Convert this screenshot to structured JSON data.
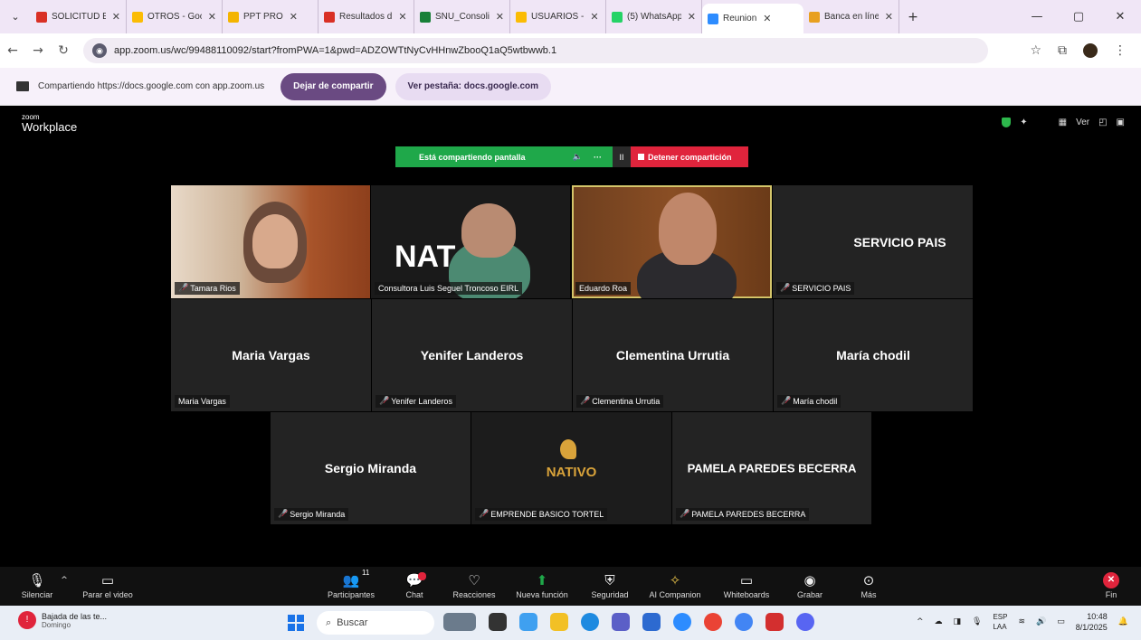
{
  "browser": {
    "tabs": [
      {
        "title": "SOLICITUD E",
        "favicon_color": "#d93025",
        "active": false
      },
      {
        "title": "OTROS - Goo",
        "favicon_color": "#fbbc04",
        "active": false
      },
      {
        "title": "PPT PRO",
        "favicon_color": "#f4b400",
        "active": false
      },
      {
        "title": "Resultados d",
        "favicon_color": "#d93025",
        "active": false
      },
      {
        "title": "SNU_Consoli",
        "favicon_color": "#188038",
        "active": false
      },
      {
        "title": "USUARIOS -",
        "favicon_color": "#fbbc04",
        "active": false
      },
      {
        "title": "(5) WhatsApp",
        "favicon_color": "#25d366",
        "active": false
      },
      {
        "title": "Reunion",
        "favicon_color": "#2d8cff",
        "active": true
      },
      {
        "title": "Banca en líne",
        "favicon_color": "#e8a020",
        "active": false
      }
    ],
    "url": "app.zoom.us/wc/99488110092/start?fromPWA=1&pwd=ADZOWTtNyCvHHnwZbooQ1aQ5wtbwwb.1",
    "sharing_text": "Compartiendo https://docs.google.com con app.zoom.us",
    "stop_sharing_label": "Dejar de compartir",
    "view_tab_label": "Ver pestaña: docs.google.com"
  },
  "zoom": {
    "brand_line1": "zoom",
    "brand_line2": "Workplace",
    "view_label": "Ver",
    "share_status": {
      "label": "Está compartiendo pantalla",
      "more": "···",
      "pause": "II",
      "stop_label": "Detener compartición"
    },
    "participants": [
      {
        "name": "Tamara Rios",
        "tag": "Tamara Rios",
        "muted": true,
        "video": true
      },
      {
        "name": "Consultora Luis Seguel Troncoso EIRL",
        "tag": "Consultora Luis Seguel Troncoso EIRL",
        "muted": false,
        "video": true
      },
      {
        "name": "Eduardo Roa",
        "tag": "Eduardo Roa",
        "muted": false,
        "video": true,
        "speaking": true
      },
      {
        "name": "SERVICIO PAIS",
        "tag": "SERVICIO PAIS",
        "muted": true,
        "video": false
      },
      {
        "name": "Maria Vargas",
        "tag": "Maria Vargas",
        "muted": false,
        "video": false
      },
      {
        "name": "Yenifer Landeros",
        "tag": "Yenifer Landeros",
        "muted": true,
        "video": false
      },
      {
        "name": "Clementina Urrutia",
        "tag": "Clementina Urrutia",
        "muted": true,
        "video": false
      },
      {
        "name": "María chodil",
        "tag": "María chodil",
        "muted": true,
        "video": false
      },
      {
        "name": "Sergio Miranda",
        "tag": "Sergio Miranda",
        "muted": true,
        "video": false
      },
      {
        "name": "NATIVO",
        "tag": "EMPRENDE BASICO TORTEL",
        "muted": true,
        "video": false
      },
      {
        "name": "PAMELA PAREDES BECERRA",
        "tag": "PAMELA PAREDES BECERRA",
        "muted": true,
        "video": false
      }
    ],
    "consultora_logo_text": "NAT",
    "toolbar": {
      "mute": "Silenciar",
      "stop_video": "Parar el video",
      "participants": "Participantes",
      "participants_count": "11",
      "chat": "Chat",
      "reactions": "Reacciones",
      "new_feature": "Nueva función",
      "security": "Seguridad",
      "ai_companion": "AI Companion",
      "whiteboards": "Whiteboards",
      "record": "Grabar",
      "more": "Más",
      "end": "Fin"
    }
  },
  "taskbar": {
    "weather_title": "Bajada de las te...",
    "weather_sub": "Domingo",
    "search_placeholder": "Buscar",
    "lang_line1": "ESP",
    "lang_line2": "LAA",
    "time": "10:48",
    "date": "8/1/2025"
  }
}
